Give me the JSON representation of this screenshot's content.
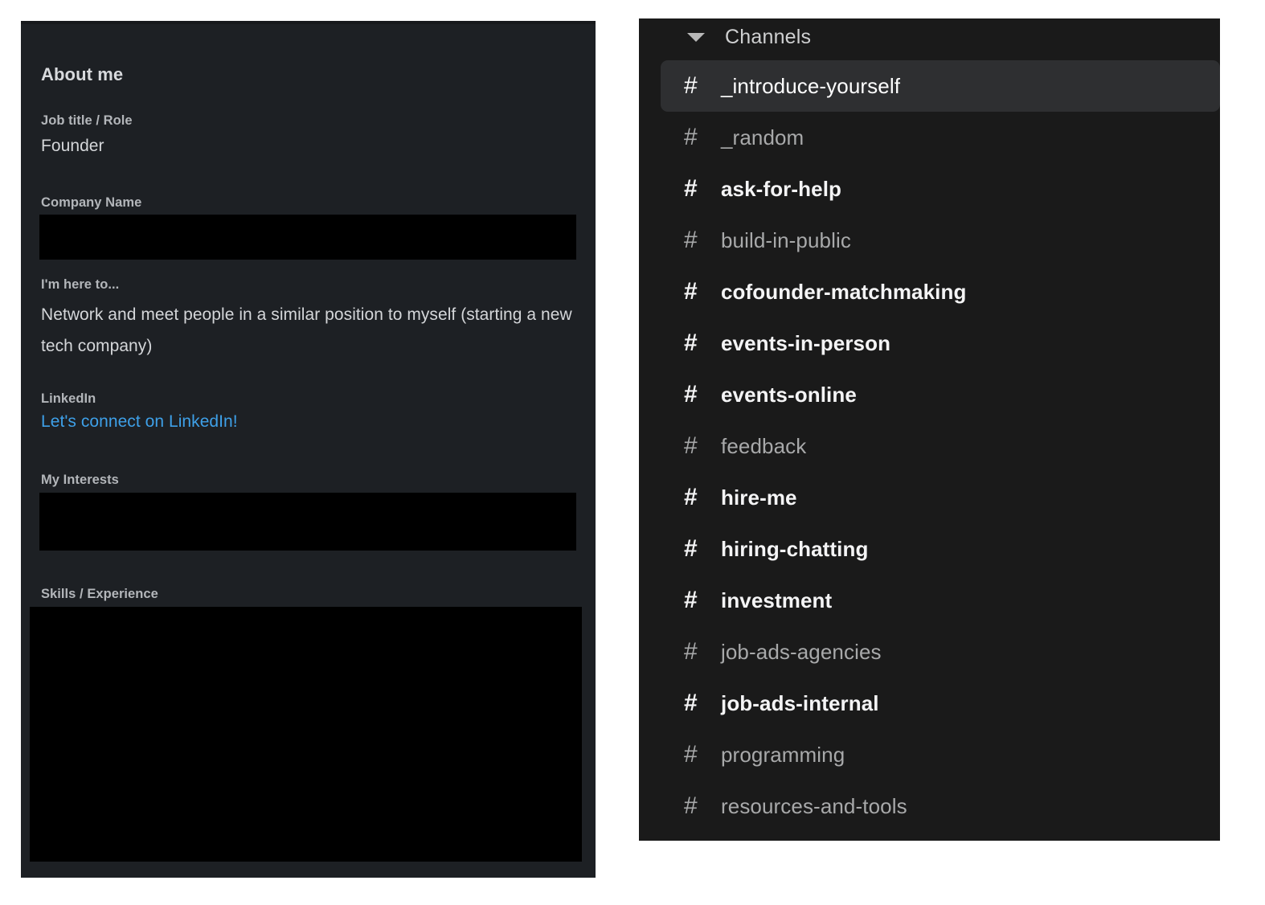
{
  "colors": {
    "profile_panel_bg": "#1d2024",
    "channels_panel_bg": "#1a1a1a",
    "selected_row_bg": "#2e2f31",
    "link_blue": "#3ea0e8",
    "label_grey": "#b3b6ba",
    "value_grey": "#d4d6d9",
    "unread_white": "#f4f4f5",
    "read_grey": "#a8a9aa",
    "redaction_black": "#000000"
  },
  "profile": {
    "title": "About me",
    "fields": {
      "job_title": {
        "label": "Job title / Role",
        "value": "Founder"
      },
      "company_name": {
        "label": "Company Name",
        "value": "",
        "redacted": true
      },
      "here_to": {
        "label": "I'm here to...",
        "value": "Network and meet people in a similar position to myself (starting a new tech company)"
      },
      "linkedin": {
        "label": "LinkedIn",
        "link_text": "Let's connect on LinkedIn!"
      },
      "my_interests": {
        "label": "My Interests",
        "value": "",
        "redacted": true
      },
      "skills_experience": {
        "label": "Skills / Experience",
        "value": "",
        "redacted": true
      }
    }
  },
  "channels_sidebar": {
    "header": {
      "label": "Channels",
      "disclosure_icon": "chevron-down-icon",
      "expanded": true
    },
    "prefix_icon": "hash-icon",
    "items": [
      {
        "name": "_introduce-yourself",
        "prefix": "#",
        "unread": false,
        "selected": true
      },
      {
        "name": "_random",
        "prefix": "#",
        "unread": false,
        "selected": false
      },
      {
        "name": "ask-for-help",
        "prefix": "#",
        "unread": true,
        "selected": false
      },
      {
        "name": "build-in-public",
        "prefix": "#",
        "unread": false,
        "selected": false
      },
      {
        "name": "cofounder-matchmaking",
        "prefix": "#",
        "unread": true,
        "selected": false
      },
      {
        "name": "events-in-person",
        "prefix": "#",
        "unread": true,
        "selected": false
      },
      {
        "name": "events-online",
        "prefix": "#",
        "unread": true,
        "selected": false
      },
      {
        "name": "feedback",
        "prefix": "#",
        "unread": false,
        "selected": false
      },
      {
        "name": "hire-me",
        "prefix": "#",
        "unread": true,
        "selected": false
      },
      {
        "name": "hiring-chatting",
        "prefix": "#",
        "unread": true,
        "selected": false
      },
      {
        "name": "investment",
        "prefix": "#",
        "unread": true,
        "selected": false
      },
      {
        "name": "job-ads-agencies",
        "prefix": "#",
        "unread": false,
        "selected": false
      },
      {
        "name": "job-ads-internal",
        "prefix": "#",
        "unread": true,
        "selected": false
      },
      {
        "name": "programming",
        "prefix": "#",
        "unread": false,
        "selected": false
      },
      {
        "name": "resources-and-tools",
        "prefix": "#",
        "unread": false,
        "selected": false
      }
    ]
  }
}
